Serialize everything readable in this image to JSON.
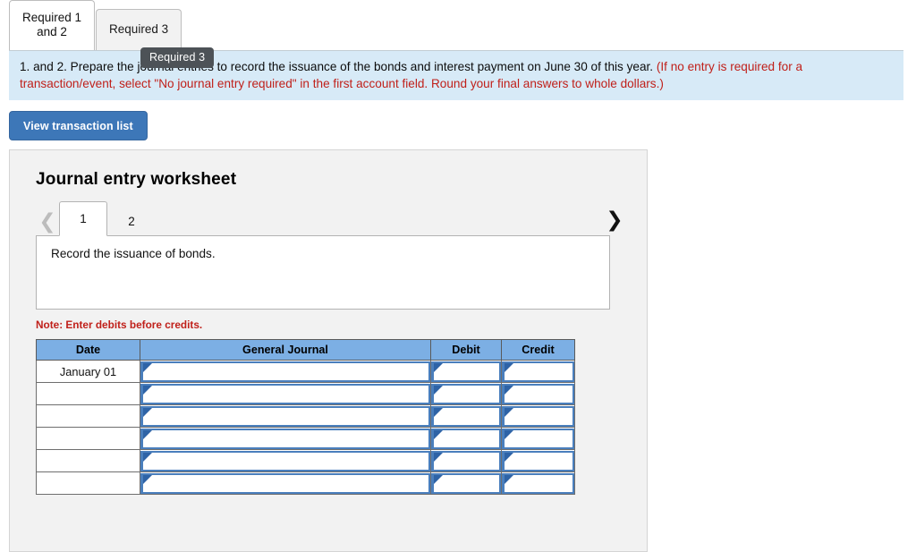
{
  "tabs": [
    {
      "label": "Required 1\nand 2",
      "active": true
    },
    {
      "label": "Required 3",
      "active": false
    }
  ],
  "tooltip": {
    "text": "Required 3"
  },
  "instruction": {
    "black_text": "1. and 2. Prepare the journal entries to record the issuance of the bonds and interest payment on June 30 of this year. ",
    "red_text": "(If no entry is required for a transaction/event, select \"No journal entry required\" in the first account field. Round your final answers to whole dollars.)"
  },
  "toolbar": {
    "view_transaction_list_label": "View transaction list"
  },
  "worksheet": {
    "title": "Journal entry worksheet",
    "prev_icon": "chevron-left-icon",
    "next_icon": "chevron-right-icon",
    "prev_enabled": false,
    "next_enabled": true,
    "pages": [
      {
        "label": "1",
        "active": true
      },
      {
        "label": "2",
        "active": false
      }
    ],
    "description": "Record the issuance of bonds.",
    "note": "Note: Enter debits before credits."
  },
  "journal_table": {
    "columns": [
      "Date",
      "General Journal",
      "Debit",
      "Credit"
    ],
    "rows": [
      {
        "date": "January 01",
        "general_journal": "",
        "debit": "",
        "credit": ""
      },
      {
        "date": "",
        "general_journal": "",
        "debit": "",
        "credit": ""
      },
      {
        "date": "",
        "general_journal": "",
        "debit": "",
        "credit": ""
      },
      {
        "date": "",
        "general_journal": "",
        "debit": "",
        "credit": ""
      },
      {
        "date": "",
        "general_journal": "",
        "debit": "",
        "credit": ""
      },
      {
        "date": "",
        "general_journal": "",
        "debit": "",
        "credit": ""
      }
    ]
  },
  "colors": {
    "accent_blue": "#3d77b8",
    "table_header_blue": "#7cafe4",
    "banner_blue": "#d7eaf7",
    "alert_red": "#c0201a",
    "field_border_blue": "#4a7fbd"
  }
}
